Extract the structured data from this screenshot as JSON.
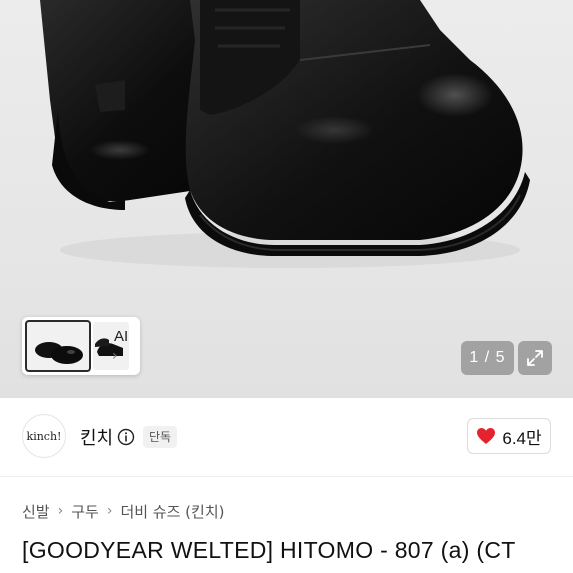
{
  "gallery": {
    "thumbnail_label": "AI",
    "page_counter": "1 / 5",
    "current_page": 1,
    "total_pages": 5
  },
  "seller": {
    "avatar_text": "kinch!",
    "name": "킨치",
    "badge": "단독"
  },
  "likes": {
    "count": "6.4만",
    "heart_color": "#e4232f"
  },
  "breadcrumb": [
    "신발",
    "구두",
    "더비 슈즈 (킨치)"
  ],
  "product": {
    "title": "[GOODYEAR WELTED] HITOMO - 807 (a) (CT"
  }
}
